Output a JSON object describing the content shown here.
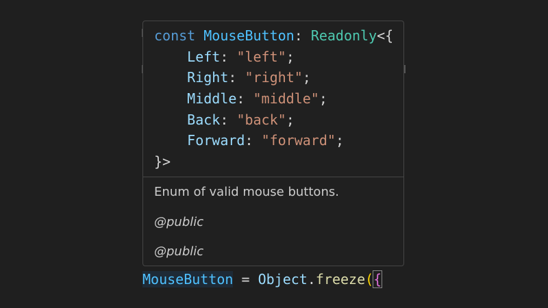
{
  "hover": {
    "signature": {
      "keyword": "const",
      "name": "MouseButton",
      "colon": ": ",
      "type": "Readonly",
      "open": "<{",
      "members": [
        {
          "key": "Left",
          "value": "\"left\""
        },
        {
          "key": "Right",
          "value": "\"right\""
        },
        {
          "key": "Middle",
          "value": "\"middle\""
        },
        {
          "key": "Back",
          "value": "\"back\""
        },
        {
          "key": "Forward",
          "value": "\"forward\""
        }
      ],
      "close": "}>"
    },
    "description": "Enum of valid mouse buttons.",
    "tags": [
      "@public",
      "@public"
    ]
  },
  "editor_line": {
    "identifier": "MouseButton",
    "operator": " = ",
    "object": "Object",
    "dot": ".",
    "method": "freeze",
    "paren": "(",
    "brace": "{"
  }
}
